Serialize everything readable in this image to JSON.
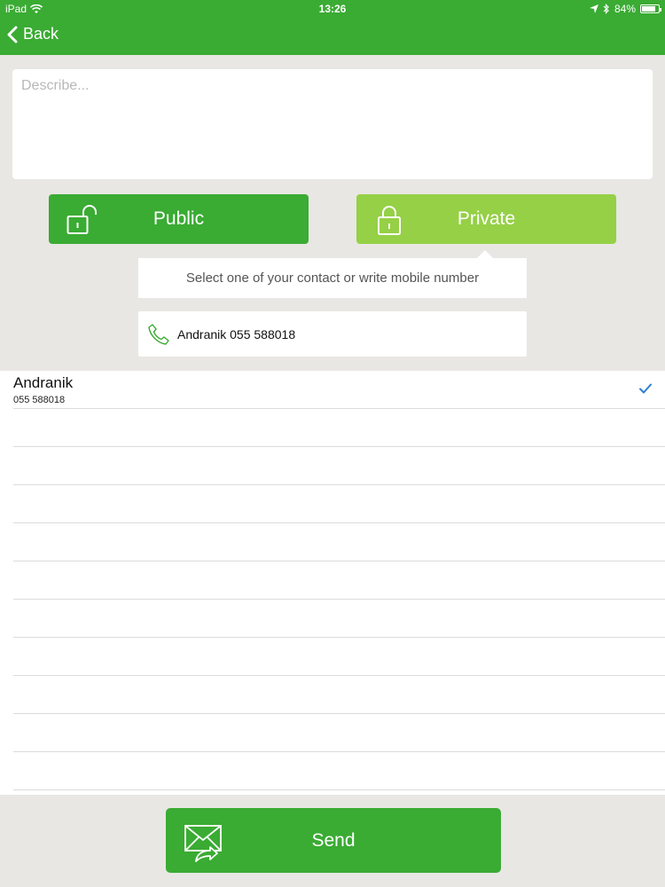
{
  "status_bar": {
    "carrier": "iPad",
    "time": "13:26",
    "battery": "84%",
    "battery_level": 0.84
  },
  "nav": {
    "back_label": "Back"
  },
  "describe": {
    "placeholder": "Describe...",
    "value": ""
  },
  "visibility": {
    "public_label": "Public",
    "private_label": "Private",
    "selected": "private"
  },
  "contact_picker": {
    "hint": "Select one of your contact or write mobile number",
    "value": "Andranik 055 588018"
  },
  "contacts": [
    {
      "name": "Andranik",
      "number": "055 588018",
      "checked": true
    }
  ],
  "send_label": "Send",
  "colors": {
    "primary": "#3aab33",
    "accent_light": "#95d046",
    "check": "#2b7fd1"
  }
}
